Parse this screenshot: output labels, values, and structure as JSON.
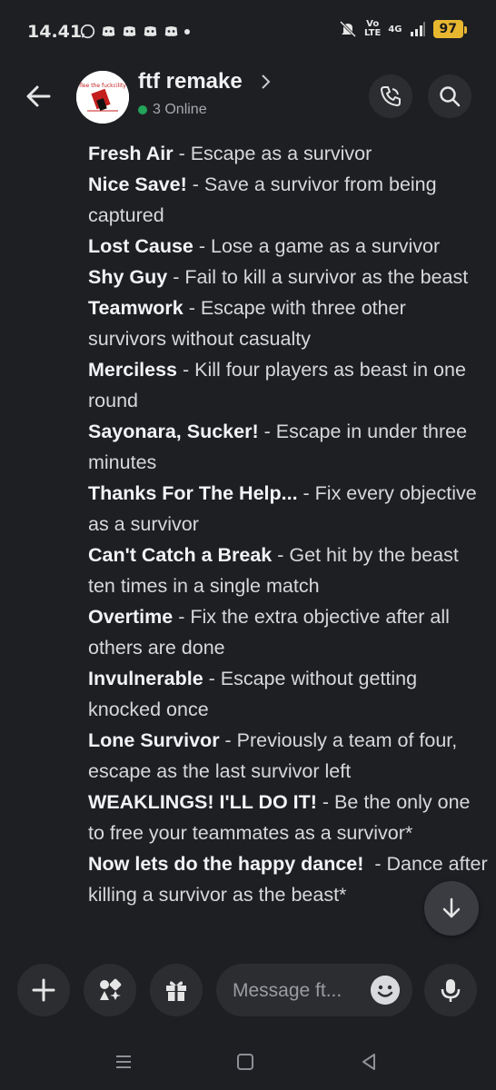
{
  "status_bar": {
    "time": "14.41",
    "volte": "Vo\nLTE",
    "network": "4G",
    "battery": "97"
  },
  "header": {
    "channel_name": "ftf remake",
    "online": "3 Online",
    "avatar_text": "flee the fuckcility"
  },
  "message": {
    "achievements": [
      {
        "name": "Fresh Air",
        "desc": " - Escape as a survivor"
      },
      {
        "name": "Nice Save!",
        "desc": " - Save a survivor from being captured"
      },
      {
        "name": "Lost Cause",
        "desc": " - Lose a game as a survivor"
      },
      {
        "name": "Shy Guy",
        "desc": " - Fail to kill a survivor as the beast"
      },
      {
        "name": "Teamwork",
        "desc": " - Escape with three other survivors without casualty"
      },
      {
        "name": "Merciless",
        "desc": " - Kill four players as beast in one round"
      },
      {
        "name": "Sayonara, Sucker!",
        "desc": " - Escape in under three minutes"
      },
      {
        "name": "Thanks For The Help...",
        "desc": " - Fix every objective as a survivor"
      },
      {
        "name": "Can't Catch a Break",
        "desc": " - Get hit by the beast ten times in a single match"
      },
      {
        "name": "Overtime",
        "desc": " - Fix the extra objective after all others are done"
      },
      {
        "name": "Invulnerable",
        "desc": " - Escape without getting knocked once"
      },
      {
        "name": "Lone Survivor",
        "desc": " - Previously a team of four, escape as the last survivor left"
      },
      {
        "name": "WEAKLINGS! I'LL DO IT!",
        "desc": " - Be the only one to free your teammates as a survivor*"
      },
      {
        "name": "Now lets do the happy dance!",
        "desc": "  - Dance after killing a survivor as the beast*"
      }
    ]
  },
  "composer": {
    "placeholder": "Message ft..."
  },
  "icons": {
    "back": "arrow-left-icon",
    "call": "phone-call-icon",
    "search": "search-icon",
    "add": "plus-icon",
    "apps": "apps-icon",
    "gift": "gift-icon",
    "emoji": "emoji-icon",
    "mic": "microphone-icon",
    "scroll": "arrow-down-icon"
  },
  "colors": {
    "background": "#1e1f23",
    "online_dot": "#23a55a",
    "battery": "#e8b730"
  }
}
